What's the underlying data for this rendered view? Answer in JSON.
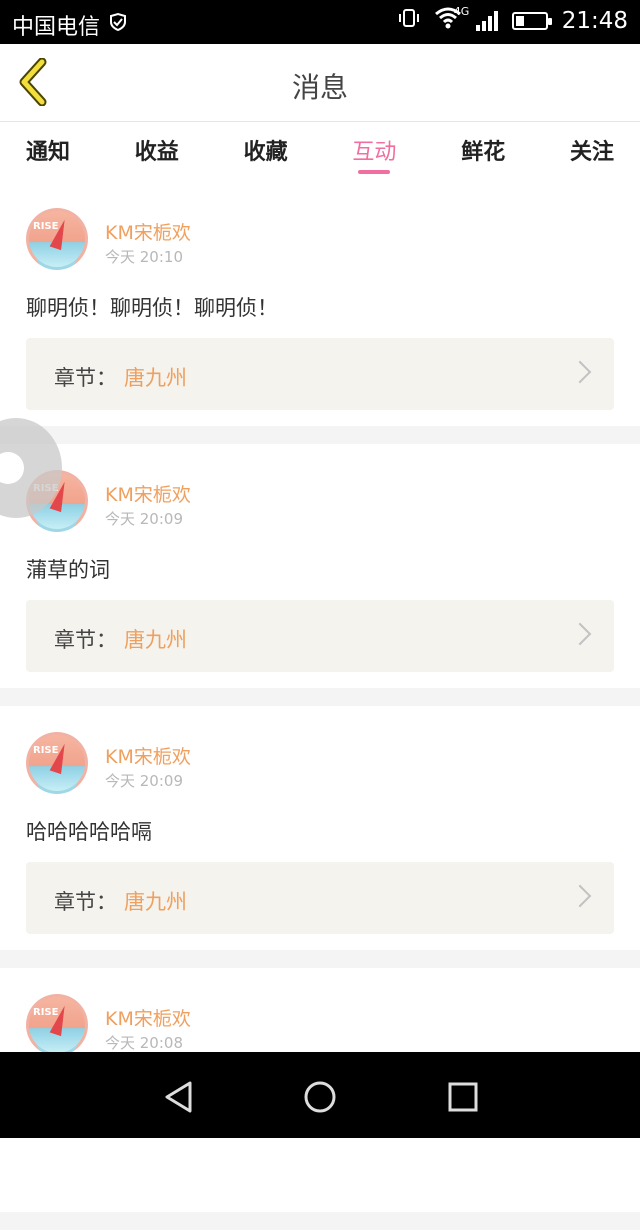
{
  "status_bar": {
    "carrier": "中国电信",
    "network": "4G",
    "time": "21:48",
    "battery_level": 0.3
  },
  "header": {
    "back_icon": "chevron-left-icon",
    "title": "消息"
  },
  "tabs": [
    {
      "label": "通知",
      "active": false
    },
    {
      "label": "收益",
      "active": false
    },
    {
      "label": "收藏",
      "active": false
    },
    {
      "label": "互动",
      "active": true
    },
    {
      "label": "鲜花",
      "active": false
    },
    {
      "label": "关注",
      "active": false
    }
  ],
  "colors": {
    "accent": "#f06fa0",
    "username": "#f0a05e",
    "chapter_bg": "#f4f3ee"
  },
  "messages": [
    {
      "user": "KM宋栀欢",
      "time": "今天 20:10",
      "text": "聊明侦！聊明侦！聊明侦！",
      "chapter_label": "章节：",
      "chapter_value": "唐九州"
    },
    {
      "user": "KM宋栀欢",
      "time": "今天 20:09",
      "text": "蒲草的词",
      "chapter_label": "章节：",
      "chapter_value": "唐九州"
    },
    {
      "user": "KM宋栀欢",
      "time": "今天 20:09",
      "text": "哈哈哈哈哈嗝",
      "chapter_label": "章节：",
      "chapter_value": "唐九州"
    },
    {
      "user": "KM宋栀欢",
      "time": "今天 20:08",
      "text": "",
      "chapter_label": "",
      "chapter_value": ""
    }
  ],
  "nav": {
    "back_icon": "triangle-back-icon",
    "home_icon": "circle-home-icon",
    "recent_icon": "square-recent-icon"
  }
}
